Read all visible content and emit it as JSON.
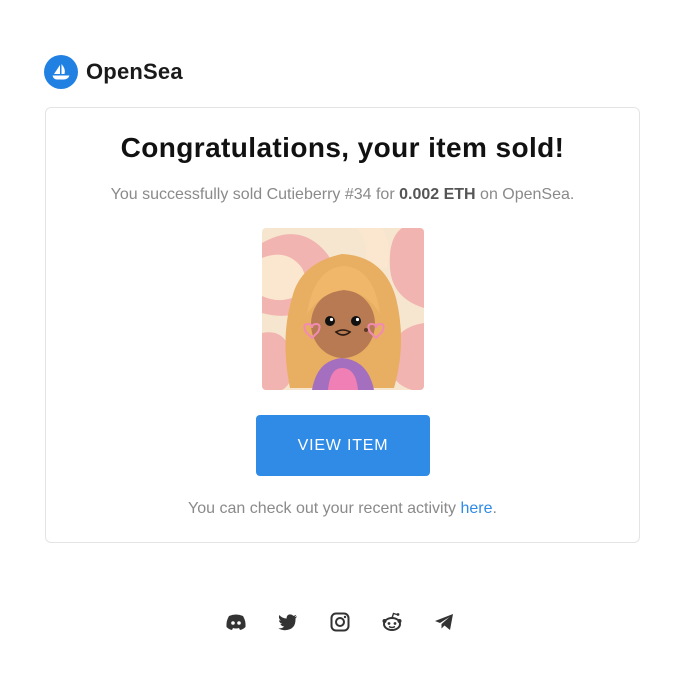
{
  "brand": {
    "name": "OpenSea",
    "logo_icon": "opensea-boat-icon",
    "accent": "#2081e2"
  },
  "card": {
    "title": "Congratulations, your item sold!",
    "subtitle_prefix": "You successfully sold Cutieberry #34 for ",
    "price": "0.002 ETH",
    "subtitle_suffix": " on OpenSea.",
    "image_icon": "cutieberry-nft-image",
    "button_label": "VIEW ITEM",
    "button_color": "#2f8be6",
    "note_prefix": "You can check out your recent activity ",
    "note_link": "here",
    "note_suffix": "."
  },
  "social": [
    {
      "icon": "discord-icon"
    },
    {
      "icon": "twitter-icon"
    },
    {
      "icon": "instagram-icon"
    },
    {
      "icon": "reddit-icon"
    },
    {
      "icon": "telegram-icon"
    }
  ]
}
